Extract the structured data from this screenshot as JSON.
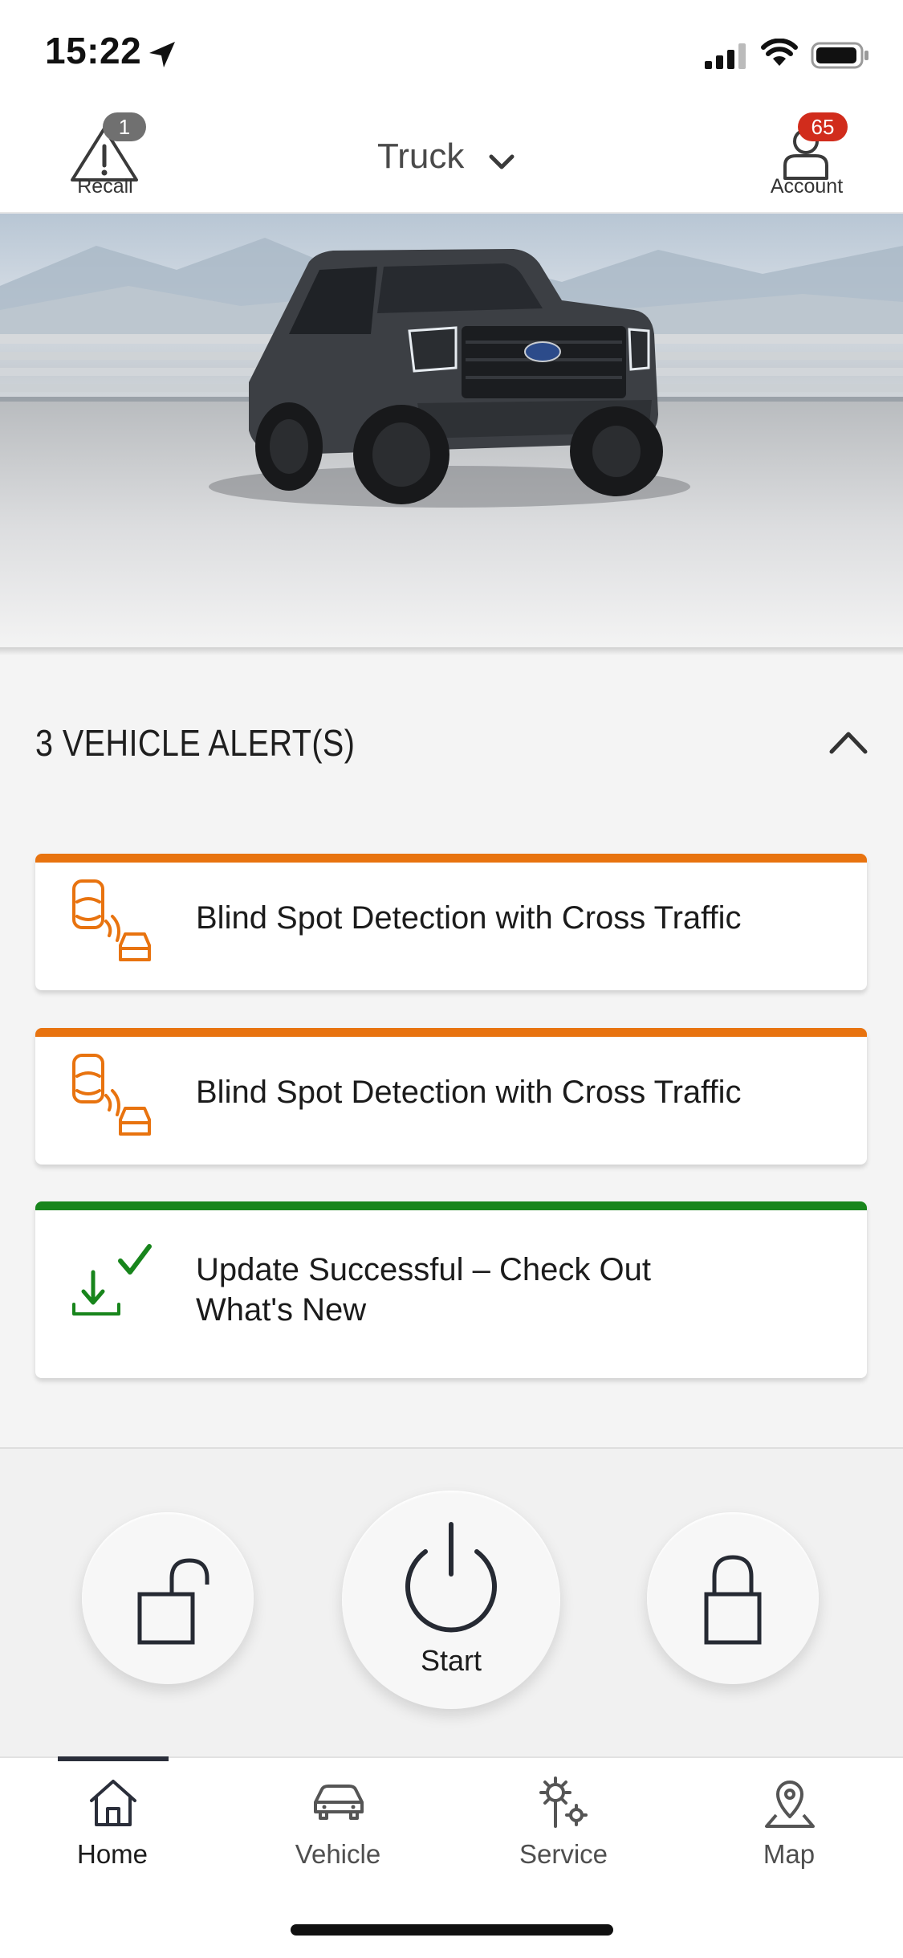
{
  "status_bar": {
    "time": "15:22"
  },
  "header": {
    "recall": {
      "label": "Recall",
      "badge": "1"
    },
    "vehicle_name": "Truck",
    "account": {
      "label": "Account",
      "badge": "65"
    }
  },
  "alerts": {
    "title": "3 VEHICLE ALERT(S)",
    "items": [
      {
        "text": "Blind Spot Detection with Cross Traffic",
        "icon": "blind-spot-icon",
        "color": "#e8730f"
      },
      {
        "text": "Blind Spot Detection with Cross Traffic",
        "icon": "blind-spot-icon",
        "color": "#e8730f"
      },
      {
        "text_line1": "Update Successful – Check Out",
        "text_line2": "What's New",
        "icon": "download-check-icon",
        "color": "#18851c"
      }
    ]
  },
  "controls": {
    "unlock_icon": "unlock-icon",
    "start_label": "Start",
    "lock_icon": "lock-icon"
  },
  "tabs": [
    {
      "label": "Home",
      "icon": "home-icon",
      "active": true
    },
    {
      "label": "Vehicle",
      "icon": "car-icon",
      "active": false
    },
    {
      "label": "Service",
      "icon": "service-gears-icon",
      "active": false
    },
    {
      "label": "Map",
      "icon": "map-pin-icon",
      "active": false
    }
  ],
  "colors": {
    "alert_orange": "#e8730f",
    "alert_green": "#18851c",
    "account_badge": "#d12c1c",
    "recall_badge": "#707070"
  }
}
